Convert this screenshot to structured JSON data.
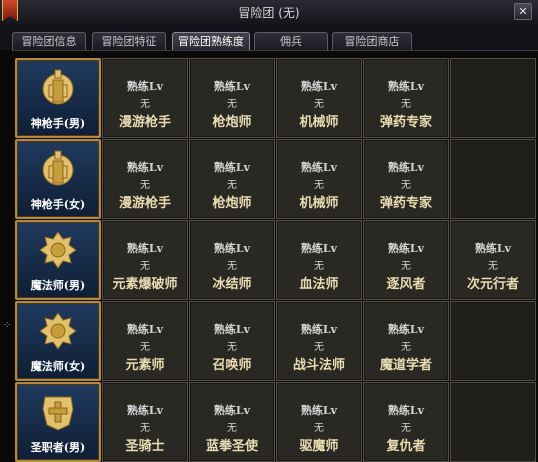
{
  "window": {
    "title": "冒险团 (无)",
    "close_label": "✕"
  },
  "tabs": [
    {
      "label": "冒险团信息",
      "active": false
    },
    {
      "label": "冒险团特征",
      "active": false
    },
    {
      "label": "冒险团熟练度",
      "active": true
    },
    {
      "label": "佣兵",
      "active": false
    },
    {
      "label": "冒险团商店",
      "active": false
    }
  ],
  "help": {
    "label": "?"
  },
  "proficiency_label": "熟练Lv",
  "proficiency_value": "无",
  "rows": [
    {
      "character": "神枪手(男)",
      "emblem": "gunner-emblem-icon",
      "jobs": [
        "漫游枪手",
        "枪炮师",
        "机械师",
        "弹药专家"
      ]
    },
    {
      "character": "神枪手(女)",
      "emblem": "gunner-emblem-icon",
      "jobs": [
        "漫游枪手",
        "枪炮师",
        "机械师",
        "弹药专家"
      ]
    },
    {
      "character": "魔法师(男)",
      "emblem": "mage-emblem-icon",
      "jobs": [
        "元素爆破师",
        "冰结师",
        "血法师",
        "逐风者",
        "次元行者"
      ]
    },
    {
      "character": "魔法师(女)",
      "emblem": "mage-emblem-icon",
      "jobs": [
        "元素师",
        "召唤师",
        "战斗法师",
        "魔道学者"
      ]
    },
    {
      "character": "圣职者(男)",
      "emblem": "priest-emblem-icon",
      "jobs": [
        "圣骑士",
        "蓝拳圣使",
        "驱魔师",
        "复仇者"
      ]
    }
  ],
  "colors": {
    "gold_border": "#b48a3e",
    "card_bg": "#1a3050",
    "cell_bg": "#2a2823",
    "job_text": "#e9dcb2"
  }
}
